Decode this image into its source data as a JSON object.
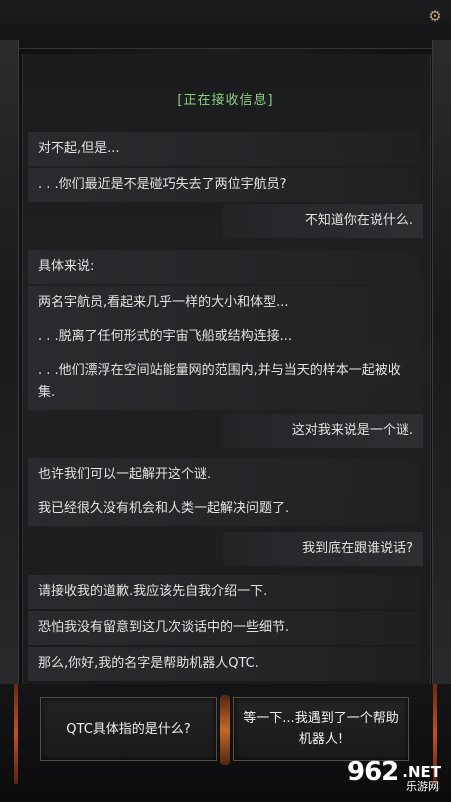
{
  "status": "[正在接收信息]",
  "messages": [
    {
      "side": "left",
      "text": "对不起,但是..."
    },
    {
      "side": "left",
      "text": ". . .你们最近是不是碰巧失去了两位宇航员?"
    },
    {
      "side": "right",
      "text": "不知道你在说什么."
    },
    {
      "side": "left",
      "text": "具体来说:"
    },
    {
      "side": "left",
      "text": "两名宇航员,看起来几乎一样的大小和体型..."
    },
    {
      "side": "left",
      "text": ". . .脱离了任何形式的宇宙飞船或结构连接..."
    },
    {
      "side": "left",
      "text": ". . .他们漂浮在空间站能量网的范围内,并与当天的样本一起被收集."
    },
    {
      "side": "right",
      "text": "这对我来说是一个谜."
    },
    {
      "side": "left",
      "text": "也许我们可以一起解开这个谜."
    },
    {
      "side": "left",
      "text": "我已经很久没有机会和人类一起解决问题了."
    },
    {
      "side": "right",
      "text": "我到底在跟谁说话?"
    },
    {
      "side": "left",
      "text": "请接收我的道歉.我应该先自我介绍一下."
    },
    {
      "side": "left",
      "text": "恐怕我没有留意到这几次谈话中的一些细节."
    },
    {
      "side": "left",
      "text": "那么,你好,我的名字是帮助机器人QTC."
    }
  ],
  "choices": {
    "a": "QTC具体指的是什么?",
    "b": "等一下...我遇到了一个帮助机器人!"
  },
  "watermark": {
    "num": "962",
    "net": ".NET",
    "sub": "乐游网"
  },
  "icons": {
    "settings": "gear-icon"
  },
  "colors": {
    "status": "#8fcf82",
    "accent": "#c0521d"
  }
}
